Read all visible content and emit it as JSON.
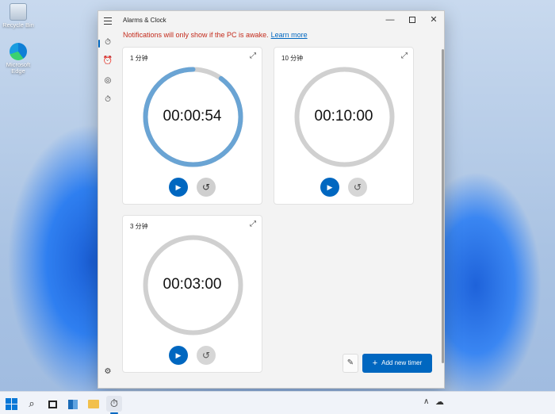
{
  "desktop": {
    "recycle_bin_label": "Recycle Bin",
    "edge_label": "Microsoft Edge"
  },
  "window": {
    "title": "Alarms & Clock",
    "minimize": "—",
    "close": "✕"
  },
  "sidebar": {
    "timer_icon": "⏱",
    "alarm_icon": "⏰",
    "world_icon": "◎",
    "stopwatch_icon": "⏱",
    "settings_icon": "⚙"
  },
  "notification": {
    "text": "Notifications will only show if the PC is awake.",
    "link": "Learn more"
  },
  "timers": [
    {
      "name": "1 分钟",
      "time": "00:00:54",
      "progress": 0.9,
      "reset_enabled": true
    },
    {
      "name": "10 分钟",
      "time": "00:10:00",
      "progress": 0,
      "reset_enabled": false
    },
    {
      "name": "3 分钟",
      "time": "00:03:00",
      "progress": 0,
      "reset_enabled": false
    }
  ],
  "icons": {
    "expand": "⤢",
    "play": "▶",
    "reset": "↺",
    "edit": "✎"
  },
  "actions": {
    "add_timer_label": "Add new timer",
    "plus": "+"
  },
  "colors": {
    "accent": "#0067c0",
    "active_ring": "#6aa4d4",
    "inactive_ring": "#d0d0d0",
    "warning": "#c42b1c"
  },
  "taskbar": {
    "search_icon": "⌕",
    "clock_icon": "⏱",
    "chevron": "∧",
    "cloud": "☁"
  }
}
